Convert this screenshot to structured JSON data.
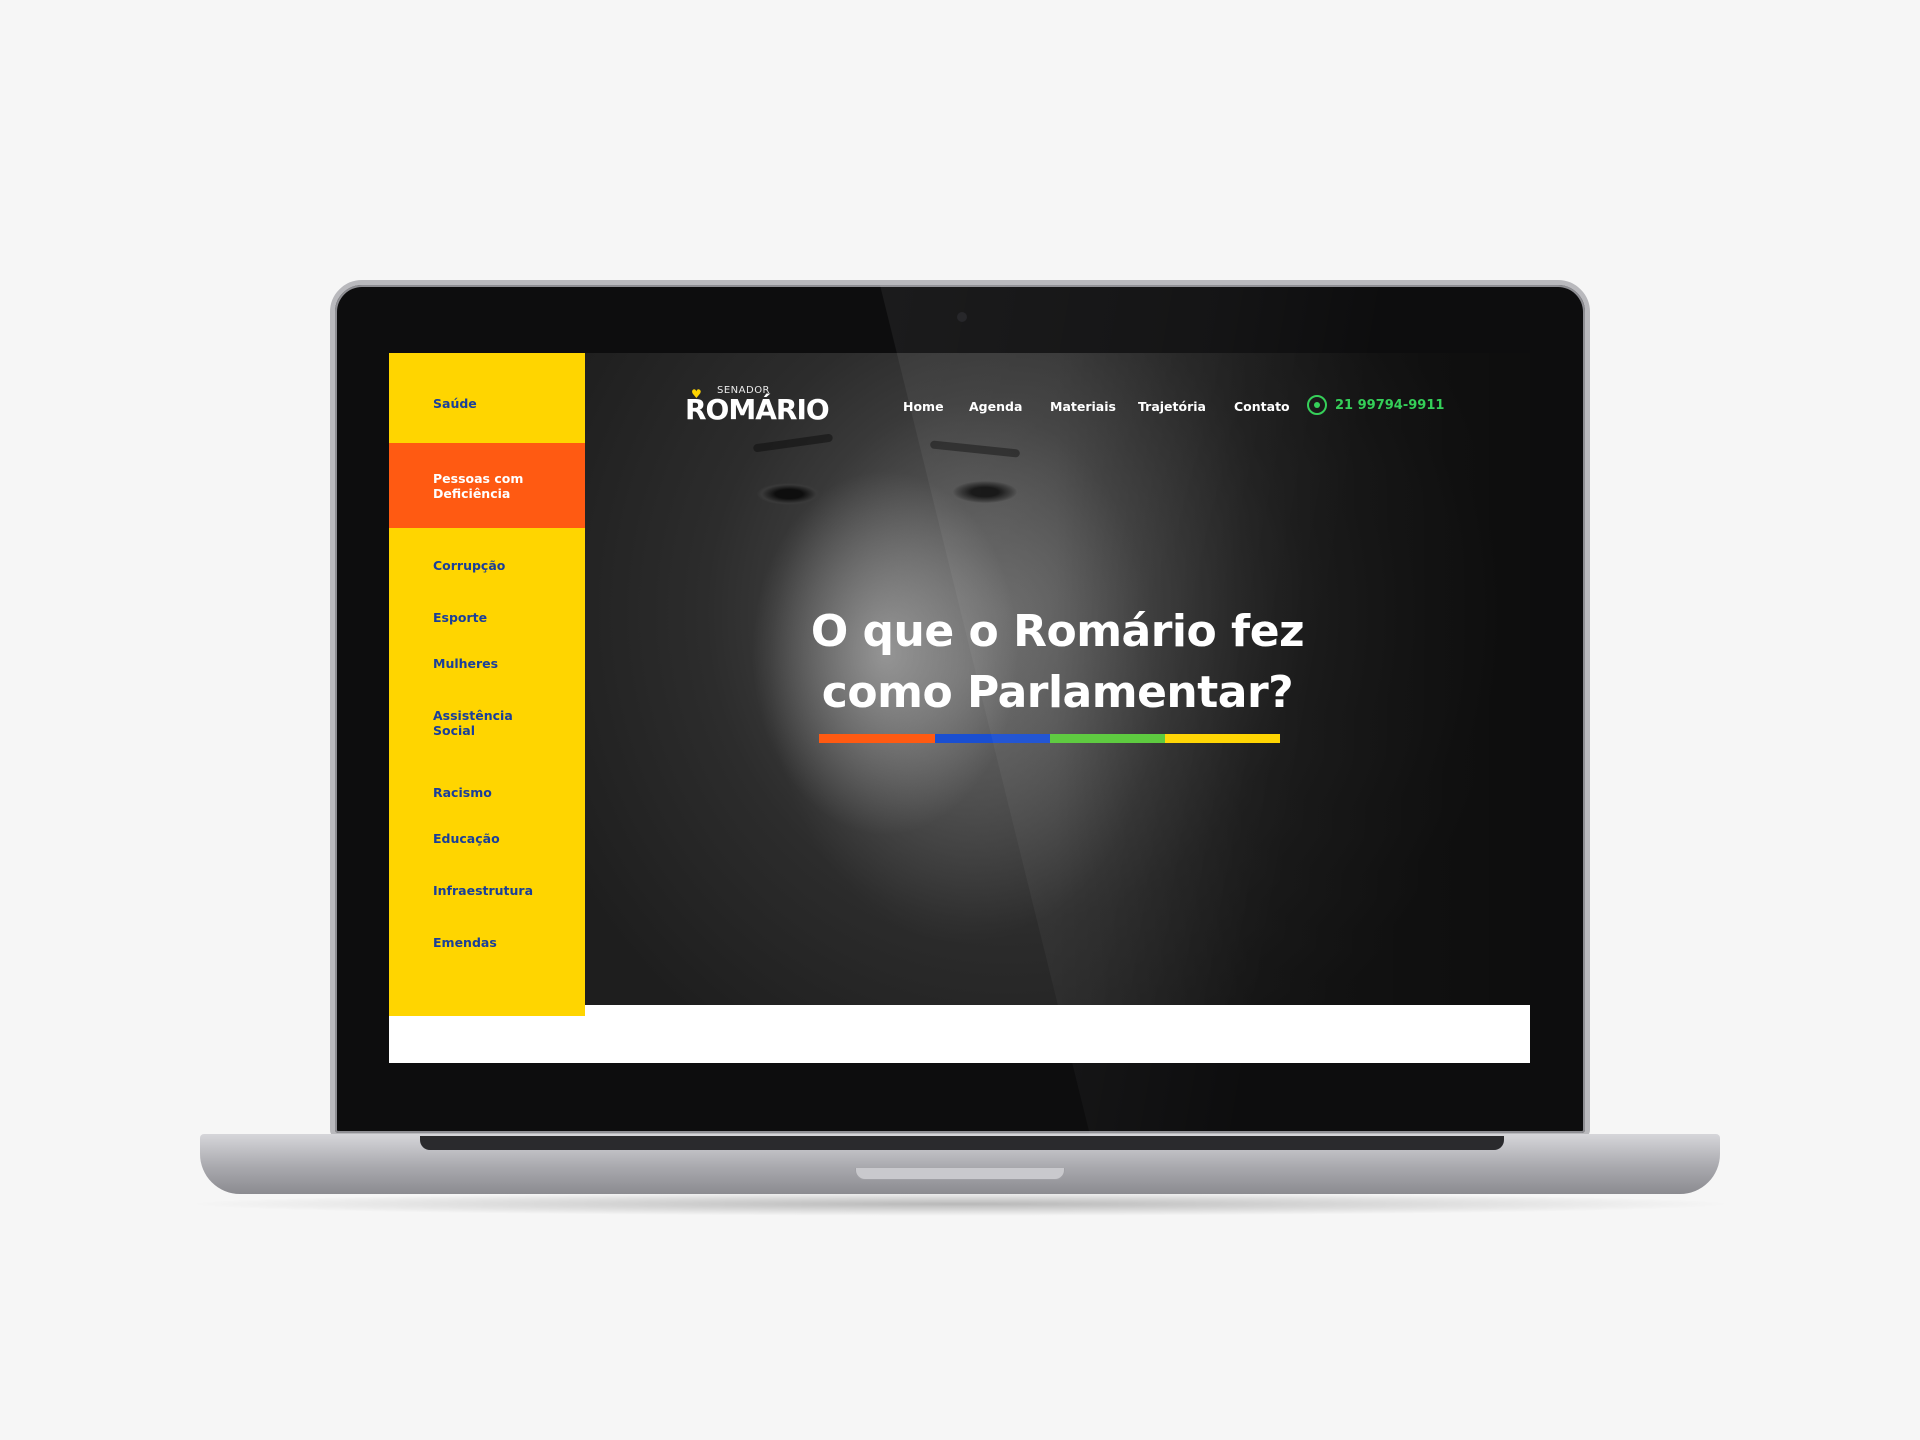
{
  "site": {
    "logo": {
      "small": "SENADOR",
      "big": "ROMÁRIO",
      "heart_icon": "heart-icon"
    },
    "nav": [
      "Home",
      "Agenda",
      "Materiais",
      "Trajetória",
      "Contato"
    ],
    "phone": {
      "icon": "whatsapp-icon",
      "number": "21 99794-9911"
    }
  },
  "sidebar": {
    "items": [
      "Saúde",
      "Pessoas com\nDeficiência",
      "Corrupção",
      "Esporte",
      "Mulheres",
      "Assistência\nSocial",
      "Racismo",
      "Educação",
      "Infraestrutura",
      "Emendas"
    ],
    "active_index": 1
  },
  "hero": {
    "headline_line1": "O que o Romário fez",
    "headline_line2": "como Parlamentar?",
    "underline_colors": [
      "#ff5a12",
      "#1a4fd1",
      "#59c93a",
      "#ffd500"
    ]
  },
  "colors": {
    "sidebar_bg": "#ffd500",
    "sidebar_text": "#1a3f9a",
    "active_bg": "#ff5a12",
    "phone": "#34d058"
  }
}
